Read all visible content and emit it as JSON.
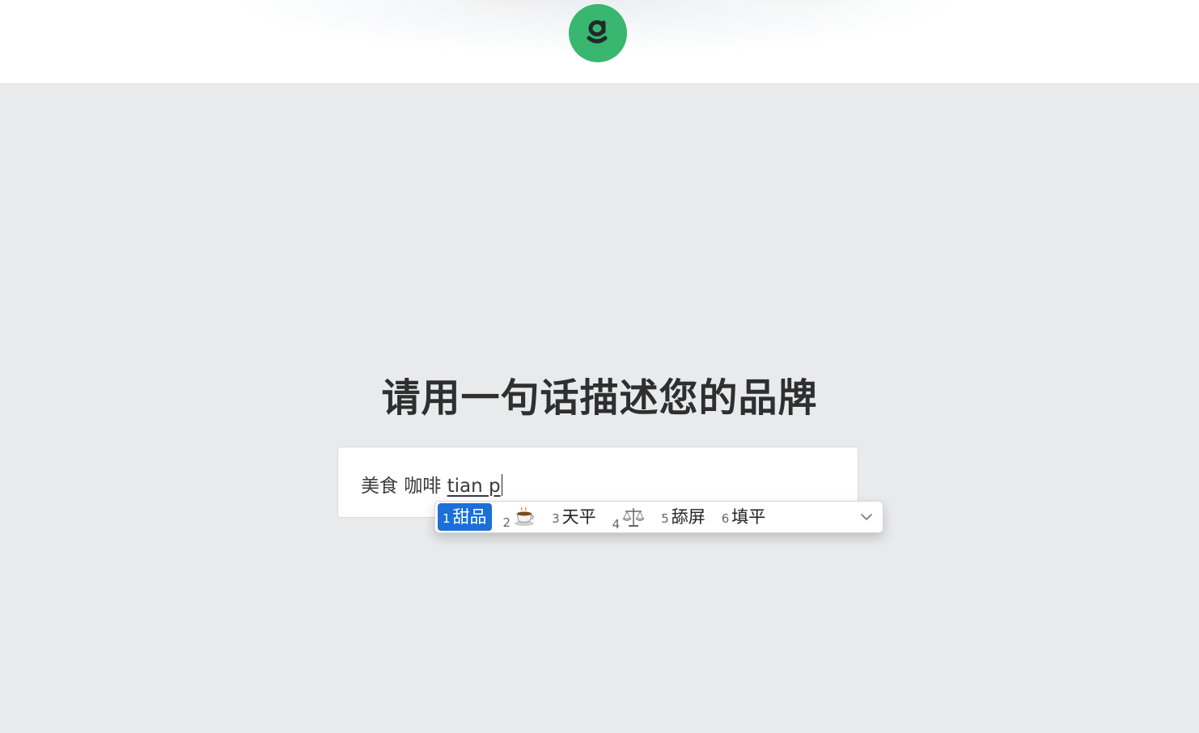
{
  "header": {
    "logo_icon": "g-logo-icon",
    "logo_color": "#39b66f"
  },
  "main": {
    "title": "请用一句话描述您的品牌",
    "input": {
      "committed_text": "美食 咖啡 ",
      "composing_text": "tian p"
    }
  },
  "ime": {
    "selected_color": "#1a6fd9",
    "candidates": [
      {
        "num": "1",
        "text": "甜品"
      },
      {
        "num": "2",
        "icon": "coffee-cup-icon"
      },
      {
        "num": "3",
        "text": "天平"
      },
      {
        "num": "4",
        "icon": "scales-icon"
      },
      {
        "num": "5",
        "text": "舔屏"
      },
      {
        "num": "6",
        "text": "填平"
      }
    ],
    "expand_icon": "chevron-down-icon"
  }
}
